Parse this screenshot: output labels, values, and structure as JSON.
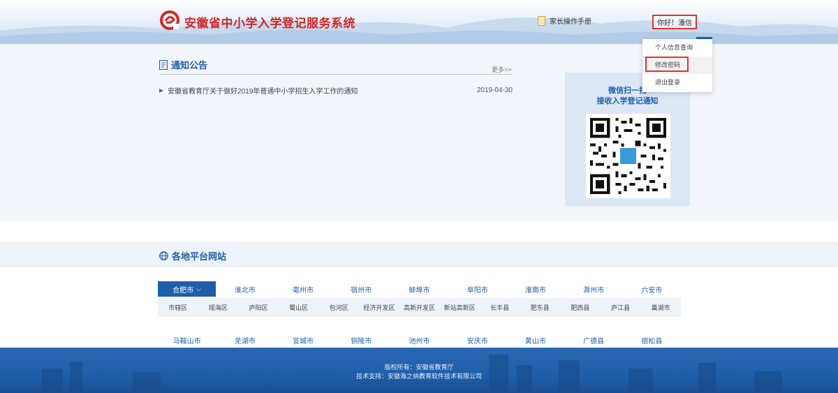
{
  "header": {
    "site_title": "安徽省中小学入学登记服务系统",
    "manual_link": "家长操作手册",
    "user_greeting": "你好！潘信"
  },
  "user_menu": {
    "items": [
      {
        "label": "个人信息查询"
      },
      {
        "label": "修改密码"
      },
      {
        "label": "退出登录"
      }
    ]
  },
  "notice": {
    "title": "通知公告",
    "more": "更多>>",
    "items": [
      {
        "text": "安徽省教育厅关于做好2019年普通中小学招生入学工作的通知",
        "date": "2019-04-30"
      }
    ]
  },
  "qr": {
    "line1": "微信扫一扫",
    "line2": "接收入学登记通知"
  },
  "regions": {
    "title": "各地平台网站",
    "row1": [
      "合肥市",
      "淮北市",
      "亳州市",
      "宿州市",
      "蚌埠市",
      "阜阳市",
      "淮南市",
      "滁州市",
      "六安市"
    ],
    "districts": [
      "市辖区",
      "瑶海区",
      "庐阳区",
      "蜀山区",
      "包河区",
      "经济开发区",
      "高新开发区",
      "新站高新区",
      "长丰县",
      "肥东县",
      "肥西县",
      "庐江县",
      "巢湖市"
    ],
    "row2": [
      "马鞍山市",
      "芜湖市",
      "宣城市",
      "铜陵市",
      "池州市",
      "安庆市",
      "黄山市",
      "广德县",
      "宿松县"
    ]
  },
  "footer": {
    "copyright": "版权所有：安徽省教育厅",
    "support": "技术支持：安徽海之纳教育软件技术有限公司"
  },
  "colors": {
    "brand_red": "#d42627",
    "brand_blue": "#1f5faa",
    "highlight_box": "#e03232",
    "footer_bg": "#1f5faa"
  }
}
